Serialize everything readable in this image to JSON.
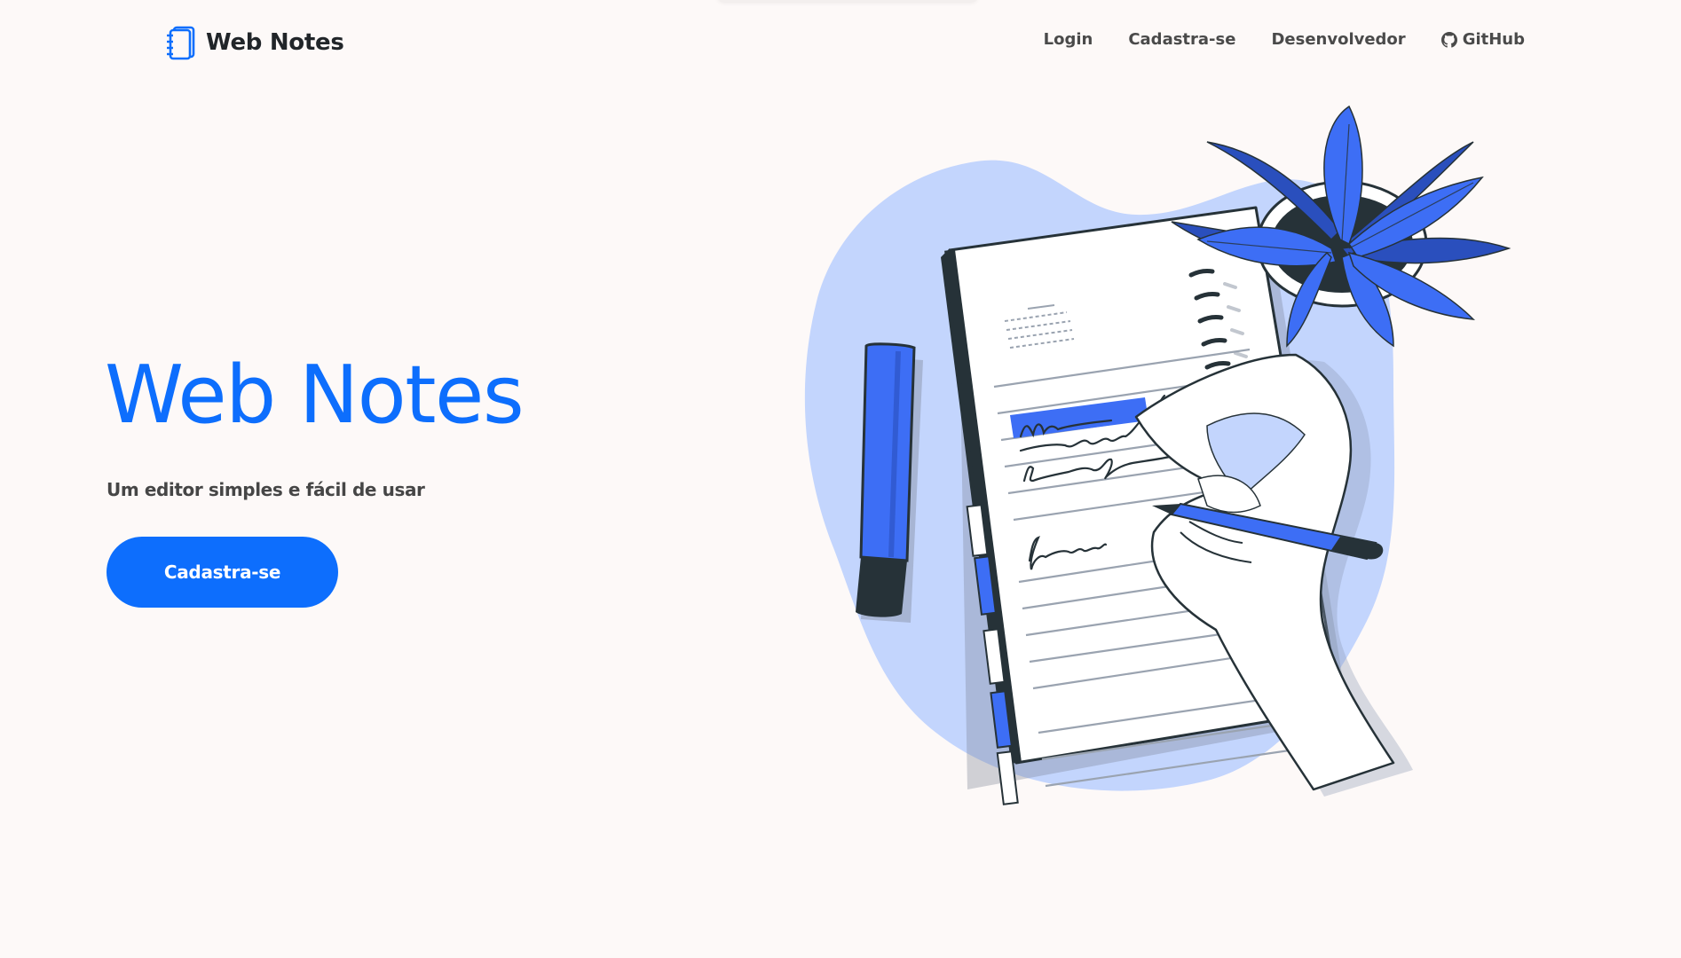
{
  "header": {
    "brand_name": "Web Notes",
    "brand_icon": "notebook-icon",
    "nav": [
      {
        "label": "Login"
      },
      {
        "label": "Cadastra-se"
      },
      {
        "label": "Desenvolvedor"
      },
      {
        "label": "GitHub",
        "icon": "github-icon"
      }
    ]
  },
  "hero": {
    "title": "Web Notes",
    "subtitle": "Um editor simples e fácil de usar",
    "cta_label": "Cadastra-se"
  },
  "colors": {
    "primary": "#0d6efd",
    "background": "#fdf9f8",
    "illustration_blob": "#c3d5fd",
    "illustration_accent": "#3d6ef5",
    "illustration_dark": "#263238"
  }
}
